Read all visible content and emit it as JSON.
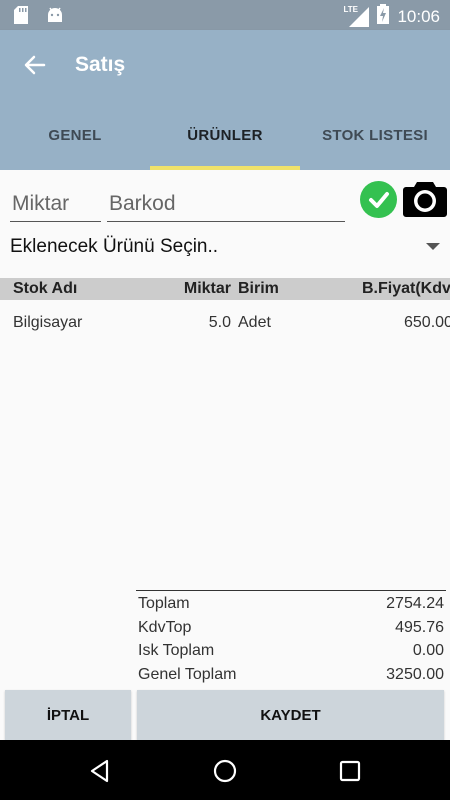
{
  "status_bar": {
    "time": "10:06",
    "network_label": "LTE"
  },
  "app_bar": {
    "title": "Satış"
  },
  "tabs": [
    {
      "label": "GENEL",
      "active": false
    },
    {
      "label": "ÜRÜNLER",
      "active": true
    },
    {
      "label": "STOK LISTESI",
      "active": false
    }
  ],
  "form": {
    "quantity_placeholder": "Miktar",
    "quantity_value": "",
    "barcode_placeholder": "Barkod",
    "barcode_value": "",
    "product_select": "Eklenecek Ürünü Seçin.."
  },
  "table": {
    "columns": [
      "Stok Adı",
      "Miktar",
      "Birim",
      "B.Fiyat(Kdv"
    ],
    "rows": [
      {
        "name": "Bilgisayar",
        "quantity": "5.0",
        "unit": "Adet",
        "price": "650.00"
      }
    ]
  },
  "totals": [
    {
      "label": "Toplam",
      "value": "2754.24"
    },
    {
      "label": "KdvTop",
      "value": "495.76"
    },
    {
      "label": "Isk Toplam",
      "value": "0.00"
    },
    {
      "label": "Genel Toplam",
      "value": "3250.00"
    }
  ],
  "actions": {
    "cancel_label": "İPTAL",
    "save_label": "KAYDET"
  },
  "colors": {
    "status_bar": "#8a9aa8",
    "app_bar": "#97b1c6",
    "tab_indicator": "#f0e26a",
    "confirm_green": "#34c150",
    "button_bg": "#cdd5db"
  },
  "icons": {
    "status_left": [
      "sd-card-icon",
      "android-icon"
    ],
    "status_right": [
      "lte-signal-icon",
      "battery-charging-icon"
    ],
    "nav": [
      "back-triangle-icon",
      "home-circle-icon",
      "recents-square-icon"
    ]
  }
}
